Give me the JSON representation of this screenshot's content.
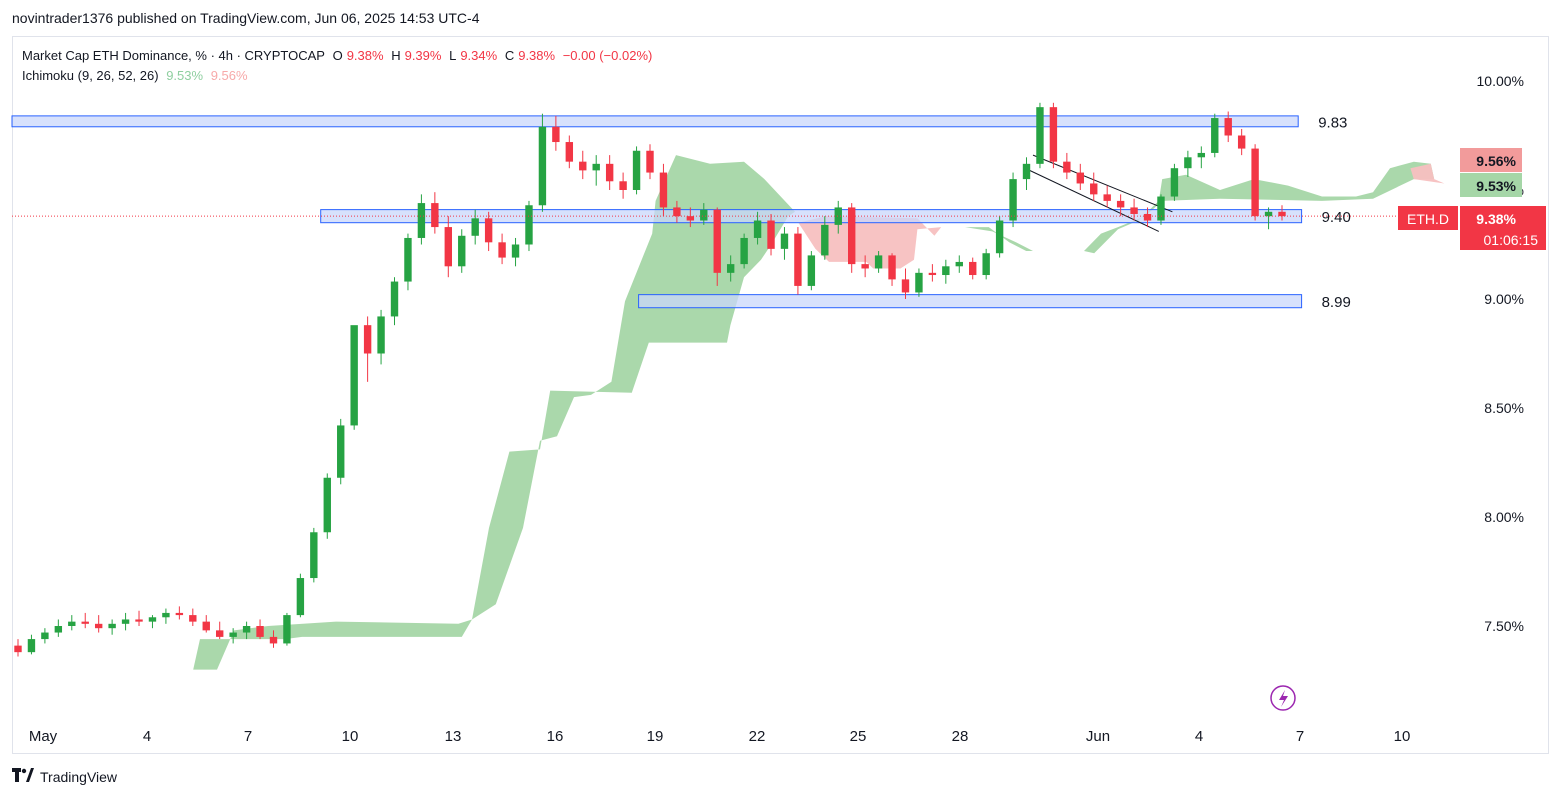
{
  "publisher": "novintrader1376 published on TradingView.com, Jun 06, 2025 14:53 UTC-4",
  "legend": {
    "title": "Market Cap ETH Dominance, % · 4h · CRYPTOCAP",
    "o_label": "O",
    "o_value": "9.38%",
    "h_label": "H",
    "h_value": "9.39%",
    "l_label": "L",
    "l_value": "9.34%",
    "c_label": "C",
    "c_value": "9.38%",
    "change": "−0.00 (−0.02%)",
    "indicator": "Ichimoku (9, 26, 52, 26)",
    "ind_val1": "9.53%",
    "ind_val2": "9.56%"
  },
  "price_axis": {
    "ticks": [
      "10.00%",
      "9.50%",
      "9.00%",
      "8.50%",
      "8.00%",
      "7.50%"
    ],
    "tag_top": "9.56%",
    "tag_mid": "9.53%",
    "symbol_tag": "ETH.D",
    "price_tag": "9.38%",
    "countdown": "01:06:15"
  },
  "date_axis": [
    "May",
    "4",
    "7",
    "10",
    "13",
    "16",
    "19",
    "22",
    "25",
    "28",
    "Jun",
    "4",
    "7",
    "10"
  ],
  "footer": {
    "brand": "TradingView"
  },
  "icons": {
    "logo": "tradingview-logo-icon",
    "flash": "lightning-icon"
  },
  "colors": {
    "up": "#26a343",
    "down": "#f23645",
    "cloud_up": "#a5d6a7",
    "cloud_down": "#f7c0c0",
    "zone": "#c9d7fb",
    "zone_border": "#2962ff"
  },
  "chart_data": {
    "type": "candlestick",
    "symbol": "ETH.D",
    "timeframe": "4h",
    "y_range": [
      7.25,
      10.12
    ],
    "x_range_days": [
      "May 1",
      "Jun 10"
    ],
    "zones": [
      {
        "label": "9.83",
        "from": "May 1",
        "to": "Jun 5",
        "low": 9.79,
        "high": 9.84
      },
      {
        "label": "9.40",
        "from": "May 9",
        "to": "Jun 6",
        "low": 9.35,
        "high": 9.41
      },
      {
        "label": "8.99",
        "from": "May 18",
        "to": "Jun 6",
        "low": 8.96,
        "high": 9.02
      }
    ],
    "trend_channel": {
      "start": "May 29",
      "end": "Jun 2",
      "upper": [
        9.66,
        9.4
      ],
      "lower": [
        9.59,
        9.31
      ]
    },
    "ohlc": [
      [
        7.41,
        7.44,
        7.36,
        7.38
      ],
      [
        7.38,
        7.46,
        7.37,
        7.44
      ],
      [
        7.44,
        7.49,
        7.42,
        7.47
      ],
      [
        7.47,
        7.53,
        7.45,
        7.5
      ],
      [
        7.5,
        7.55,
        7.48,
        7.52
      ],
      [
        7.52,
        7.56,
        7.49,
        7.51
      ],
      [
        7.51,
        7.55,
        7.47,
        7.49
      ],
      [
        7.49,
        7.53,
        7.46,
        7.51
      ],
      [
        7.51,
        7.56,
        7.48,
        7.53
      ],
      [
        7.53,
        7.57,
        7.5,
        7.52
      ],
      [
        7.52,
        7.55,
        7.49,
        7.54
      ],
      [
        7.54,
        7.58,
        7.51,
        7.56
      ],
      [
        7.56,
        7.59,
        7.53,
        7.55
      ],
      [
        7.55,
        7.58,
        7.5,
        7.52
      ],
      [
        7.52,
        7.55,
        7.47,
        7.48
      ],
      [
        7.48,
        7.52,
        7.44,
        7.45
      ],
      [
        7.45,
        7.49,
        7.42,
        7.47
      ],
      [
        7.47,
        7.52,
        7.44,
        7.5
      ],
      [
        7.5,
        7.53,
        7.44,
        7.45
      ],
      [
        7.45,
        7.48,
        7.4,
        7.42
      ],
      [
        7.42,
        7.56,
        7.41,
        7.55
      ],
      [
        7.55,
        7.74,
        7.54,
        7.72
      ],
      [
        7.72,
        7.95,
        7.7,
        7.93
      ],
      [
        7.93,
        8.2,
        7.9,
        8.18
      ],
      [
        8.18,
        8.45,
        8.15,
        8.42
      ],
      [
        8.42,
        8.7,
        8.4,
        8.88
      ],
      [
        8.88,
        8.92,
        8.62,
        8.75
      ],
      [
        8.75,
        8.95,
        8.7,
        8.92
      ],
      [
        8.92,
        9.1,
        8.88,
        9.08
      ],
      [
        9.08,
        9.3,
        9.04,
        9.28
      ],
      [
        9.28,
        9.48,
        9.25,
        9.44
      ],
      [
        9.44,
        9.49,
        9.3,
        9.33
      ],
      [
        9.33,
        9.38,
        9.1,
        9.15
      ],
      [
        9.15,
        9.32,
        9.12,
        9.29
      ],
      [
        9.29,
        9.41,
        9.25,
        9.37
      ],
      [
        9.37,
        9.4,
        9.22,
        9.26
      ],
      [
        9.26,
        9.3,
        9.16,
        9.19
      ],
      [
        9.19,
        9.28,
        9.15,
        9.25
      ],
      [
        9.25,
        9.45,
        9.22,
        9.43
      ],
      [
        9.43,
        9.85,
        9.4,
        9.79
      ],
      [
        9.79,
        9.84,
        9.68,
        9.72
      ],
      [
        9.72,
        9.75,
        9.6,
        9.63
      ],
      [
        9.63,
        9.68,
        9.55,
        9.59
      ],
      [
        9.59,
        9.66,
        9.52,
        9.62
      ],
      [
        9.62,
        9.66,
        9.5,
        9.54
      ],
      [
        9.54,
        9.58,
        9.46,
        9.5
      ],
      [
        9.5,
        9.7,
        9.48,
        9.68
      ],
      [
        9.68,
        9.71,
        9.55,
        9.58
      ],
      [
        9.58,
        9.62,
        9.38,
        9.42
      ],
      [
        9.42,
        9.45,
        9.35,
        9.38
      ],
      [
        9.38,
        9.42,
        9.33,
        9.36
      ],
      [
        9.36,
        9.44,
        9.34,
        9.41
      ],
      [
        9.41,
        9.42,
        9.06,
        9.12
      ],
      [
        9.12,
        9.2,
        9.08,
        9.16
      ],
      [
        9.16,
        9.3,
        9.14,
        9.28
      ],
      [
        9.28,
        9.4,
        9.25,
        9.36
      ],
      [
        9.36,
        9.39,
        9.2,
        9.23
      ],
      [
        9.23,
        9.33,
        9.18,
        9.3
      ],
      [
        9.3,
        9.33,
        9.02,
        9.06
      ],
      [
        9.06,
        9.22,
        9.04,
        9.2
      ],
      [
        9.2,
        9.38,
        9.18,
        9.34
      ],
      [
        9.34,
        9.45,
        9.3,
        9.42
      ],
      [
        9.42,
        9.44,
        9.12,
        9.16
      ],
      [
        9.16,
        9.2,
        9.1,
        9.14
      ],
      [
        9.14,
        9.22,
        9.12,
        9.2
      ],
      [
        9.2,
        9.21,
        9.06,
        9.09
      ],
      [
        9.09,
        9.14,
        9.0,
        9.03
      ],
      [
        9.03,
        9.14,
        9.01,
        9.12
      ],
      [
        9.12,
        9.16,
        9.08,
        9.11
      ],
      [
        9.11,
        9.18,
        9.07,
        9.15
      ],
      [
        9.15,
        9.2,
        9.12,
        9.17
      ],
      [
        9.17,
        9.19,
        9.09,
        9.11
      ],
      [
        9.11,
        9.23,
        9.09,
        9.21
      ],
      [
        9.21,
        9.38,
        9.19,
        9.36
      ],
      [
        9.36,
        9.58,
        9.33,
        9.55
      ],
      [
        9.55,
        9.65,
        9.5,
        9.62
      ],
      [
        9.62,
        9.9,
        9.6,
        9.88
      ],
      [
        9.88,
        9.9,
        9.6,
        9.63
      ],
      [
        9.63,
        9.67,
        9.55,
        9.58
      ],
      [
        9.58,
        9.62,
        9.5,
        9.53
      ],
      [
        9.53,
        9.58,
        9.45,
        9.48
      ],
      [
        9.48,
        9.52,
        9.42,
        9.45
      ],
      [
        9.45,
        9.48,
        9.38,
        9.42
      ],
      [
        9.42,
        9.46,
        9.36,
        9.39
      ],
      [
        9.39,
        9.42,
        9.33,
        9.36
      ],
      [
        9.36,
        9.48,
        9.34,
        9.47
      ],
      [
        9.47,
        9.62,
        9.45,
        9.6
      ],
      [
        9.6,
        9.68,
        9.56,
        9.65
      ],
      [
        9.65,
        9.7,
        9.6,
        9.67
      ],
      [
        9.67,
        9.85,
        9.65,
        9.83
      ],
      [
        9.83,
        9.86,
        9.72,
        9.75
      ],
      [
        9.75,
        9.78,
        9.66,
        9.69
      ],
      [
        9.69,
        9.71,
        9.36,
        9.38
      ],
      [
        9.38,
        9.42,
        9.32,
        9.4
      ],
      [
        9.4,
        9.43,
        9.36,
        9.38
      ]
    ]
  }
}
